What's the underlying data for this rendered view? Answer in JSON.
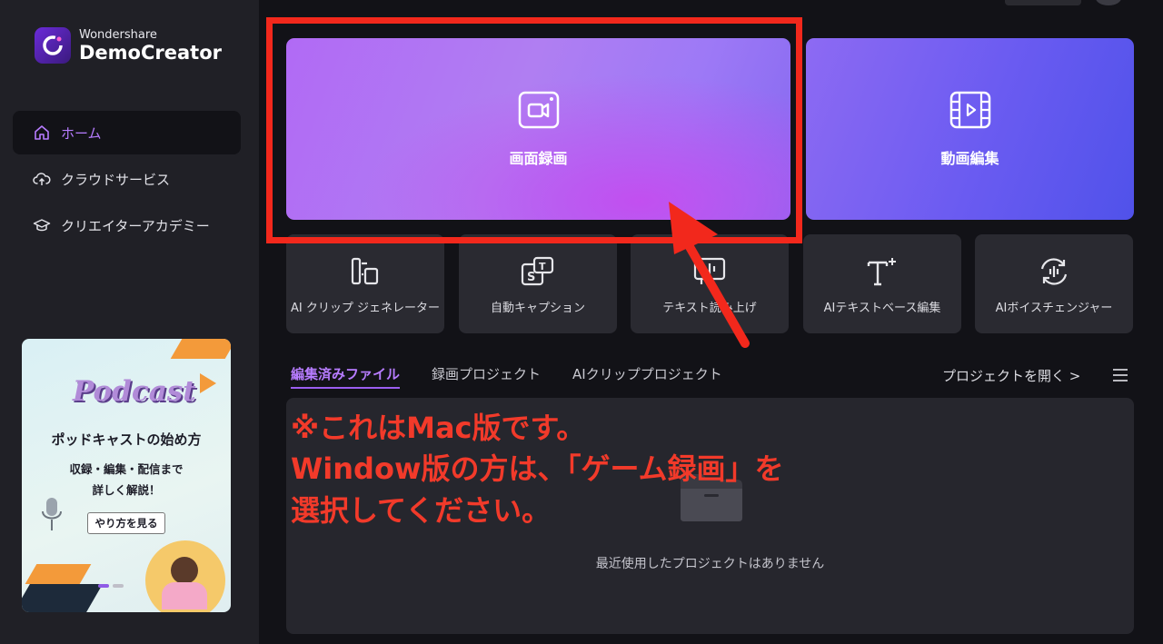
{
  "app": {
    "brand_top": "Wondershare",
    "brand_main": "DemoCreator"
  },
  "sidebar": {
    "items": [
      {
        "label": "ホーム",
        "icon": "home-icon",
        "active": true
      },
      {
        "label": "クラウドサービス",
        "icon": "cloud-upload-icon",
        "active": false
      },
      {
        "label": "クリエイターアカデミー",
        "icon": "graduation-cap-icon",
        "active": false
      }
    ]
  },
  "promo": {
    "podcast_word": "Podcast",
    "title": "ポッドキャストの始め方",
    "subtitle_1": "収録・編集・配信まで",
    "subtitle_2": "詳しく解説！",
    "button": "やり方を見る"
  },
  "hero": {
    "screen_record_label": "画面録画",
    "video_edit_label": "動画編集"
  },
  "tools": [
    {
      "label": "AI クリップ ジェネレーター",
      "icon": "ai-clip-icon"
    },
    {
      "label": "自動キャプション",
      "icon": "auto-caption-icon"
    },
    {
      "label": "テキスト読み上げ",
      "icon": "text-to-speech-icon"
    },
    {
      "label": "AIテキストベース編集",
      "icon": "text-edit-icon"
    },
    {
      "label": "AIボイスチェンジャー",
      "icon": "voice-changer-icon"
    }
  ],
  "tabs": [
    {
      "label": "編集済みファイル",
      "active": true
    },
    {
      "label": "録画プロジェクト",
      "active": false
    },
    {
      "label": "AIクリッププロジェクト",
      "active": false
    }
  ],
  "open_project": "プロジェクトを開く >",
  "recent": {
    "empty_text": "最近使用したプロジェクトはありません"
  },
  "annotation": {
    "line1": "※これはMac版です。",
    "line2": "Window版の方は、「ゲーム録画」を",
    "line3": "選択してください。"
  },
  "colors": {
    "accent": "#b77cff",
    "highlight_red": "#f2281c"
  }
}
